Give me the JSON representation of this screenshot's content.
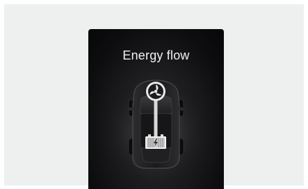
{
  "screen": {
    "title": "Energy flow"
  },
  "diagram": {
    "vehicle": "car-top-view",
    "power_source_icon": "motor-fan-icon",
    "storage_icon": "battery-icon",
    "flow_color": "#d8d8d8"
  }
}
